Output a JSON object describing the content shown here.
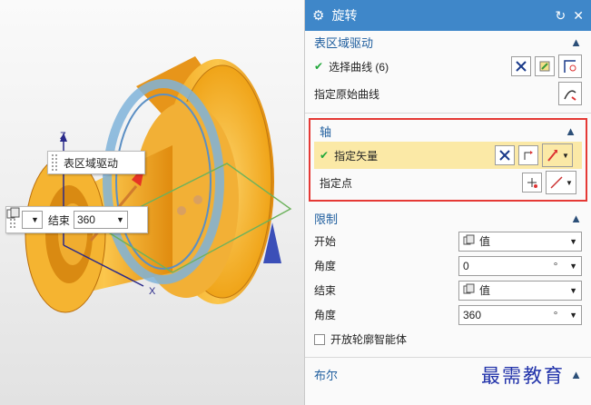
{
  "viewport": {
    "callout_label": "表区域驱动",
    "mini_toolbar": {
      "end_label": "结束",
      "end_value": "360",
      "start_icon": "value-icon"
    },
    "axes": {
      "x": "X",
      "z": "Z"
    }
  },
  "panel": {
    "title": "旋转",
    "title_icon": "gear-icon",
    "reset_icon": "reset-icon",
    "close_icon": "close-icon",
    "section_region": {
      "heading": "表区域驱动",
      "select_curve": "选择曲线 (6)",
      "origin_curve": "指定原始曲线"
    },
    "section_axis": {
      "heading": "轴",
      "vector": "指定矢量",
      "point": "指定点"
    },
    "section_limit": {
      "heading": "限制",
      "start_label": "开始",
      "start_value": "值",
      "angle1_label": "角度",
      "angle1_value": "0",
      "angle1_unit": "°",
      "end_label": "结束",
      "end_value": "值",
      "angle2_label": "角度",
      "angle2_value": "360",
      "angle2_unit": "°",
      "open_profile": "开放轮廓智能体"
    },
    "section_boolean": {
      "heading": "布尔"
    }
  },
  "watermark": "最需教育",
  "colors": {
    "title_bar": "#3f87c9",
    "section_heading": "#1f5e9e",
    "highlight_red": "#e53935",
    "part_orange": "#f5a623"
  }
}
